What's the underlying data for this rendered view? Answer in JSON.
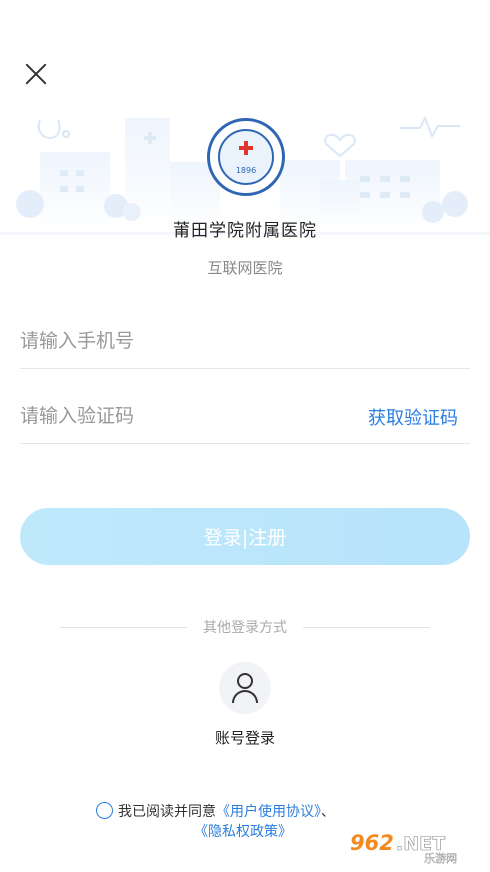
{
  "header": {
    "close_icon": "close-icon"
  },
  "hospital": {
    "logo_year": "1896",
    "name": "莆田学院附属医院",
    "subtitle": "互联网医院"
  },
  "form": {
    "phone_placeholder": "请输入手机号",
    "code_placeholder": "请输入验证码",
    "get_code_label": "获取验证码",
    "login_button_label": "登录|注册"
  },
  "other_login": {
    "divider_label": "其他登录方式",
    "account_icon": "user-icon",
    "account_label": "账号登录"
  },
  "agreement": {
    "prefix": "我已阅读并同意",
    "user_agreement": "《用户使用协议》",
    "separator": "、",
    "privacy_policy": "《隐私权政策》"
  },
  "watermark": {
    "text": "962.NET",
    "subtext": "乐游网"
  },
  "colors": {
    "accent": "#2b7ee0",
    "button": "#bfe9fb",
    "logo_blue": "#2f66b3",
    "logo_red": "#e0342f"
  }
}
